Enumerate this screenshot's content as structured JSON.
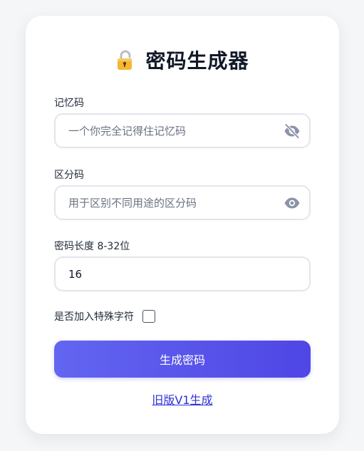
{
  "header": {
    "title": "密码生成器",
    "icon": "lock-icon"
  },
  "form": {
    "memory": {
      "label": "记忆码",
      "value": "",
      "placeholder": "一个你完全记得住记忆码",
      "visibility_icon": "eye-off-icon"
    },
    "distinguish": {
      "label": "区分码",
      "value": "",
      "placeholder": "用于区别不同用途的区分码",
      "visibility_icon": "eye-icon"
    },
    "length": {
      "label": "密码长度 8-32位",
      "value": "16"
    },
    "special_chars": {
      "label": "是否加入特殊字符",
      "checked": false
    }
  },
  "actions": {
    "generate_label": "生成密码",
    "old_version_link": "旧版V1生成"
  },
  "colors": {
    "background": "#f5f6f8",
    "card": "#ffffff",
    "accent_start": "#6366f1",
    "accent_end": "#4f46e5",
    "input_border": "#e2e5ec",
    "icon_gray": "#8b93a7",
    "link": "#2f2fd6",
    "lock_gold": "#f5b731"
  }
}
